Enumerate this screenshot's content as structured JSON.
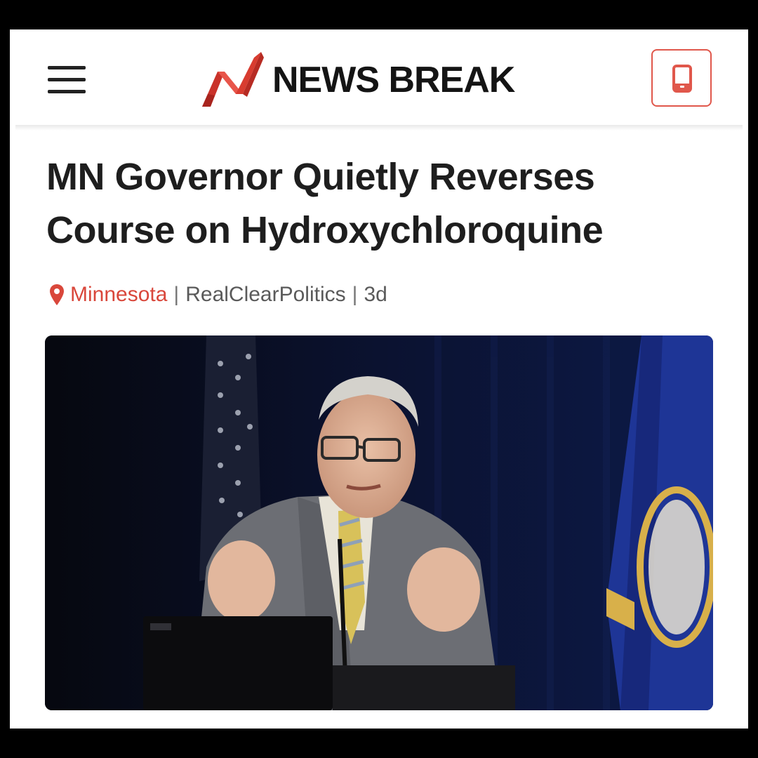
{
  "app": {
    "brand": "NEWS BREAK",
    "brand_color": "#e0574b",
    "menu_icon": "hamburger-menu-icon",
    "app_icon": "mobile-phone-icon"
  },
  "article": {
    "title_line1": "MN Governor Quietly Reverses",
    "title_line2": "Course on Hydroxychloroquine",
    "location": "Minnesota",
    "location_icon": "location-pin-icon",
    "separator": "|",
    "source": "RealClearPolitics",
    "age": "3d",
    "image_subject": "governor-speaking-at-podium-photo"
  }
}
